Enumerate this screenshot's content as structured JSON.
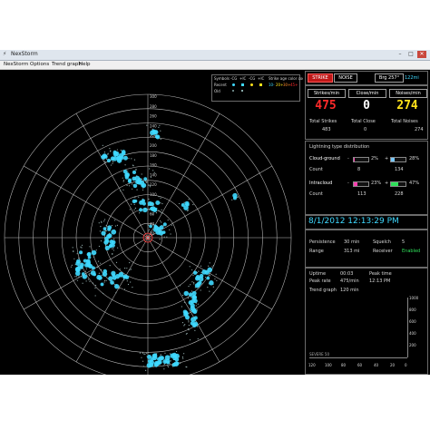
{
  "window": {
    "title": "NexStorm"
  },
  "menu": [
    "NexStorm",
    "Options",
    "Trend graph",
    "Help"
  ],
  "radar": {
    "bearing_labels": [
      "300",
      "280",
      "260",
      "240",
      "220",
      "200",
      "180",
      "160",
      "140",
      "120",
      "100",
      "80",
      "60",
      "40",
      "20"
    ],
    "legend": {
      "symbols_label": "Symbols",
      "symbol_types": [
        "-CG",
        "+IC",
        "-CG",
        "+IC"
      ],
      "row_labels": [
        "Recent",
        "Old"
      ],
      "age_label": "Strike age color codes",
      "age_values": [
        "10-",
        "20+",
        "30+",
        "45+"
      ]
    }
  },
  "panel": {
    "mode_buttons": [
      "STRIKE",
      "NOISE"
    ],
    "bearing": "Brg 257°",
    "range_readout": "122mi",
    "strikes_per_min_label": "Strikes/min",
    "strikes_per_min_value": "475",
    "close_per_min_label": "Close/min",
    "close_per_min_value": "0",
    "noises_per_min_label": "Noises/min",
    "noises_per_min_value": "274",
    "total_strikes_label": "Total Strikes",
    "total_strikes_value": "483",
    "total_close_label": "Total Close",
    "total_close_value": "0",
    "total_noises_label": "Total Noises",
    "total_noises_value": "274",
    "distribution_title": "Lightning type distribution",
    "cg_label": "Cloud-ground",
    "cg_neg_pct": "2%",
    "cg_pos_pct": "28%",
    "cg_neg_fill": 0.02,
    "cg_pos_fill": 0.28,
    "cg_count_label": "Count",
    "cg_count_neg": "8",
    "cg_count_pos": "134",
    "ic_label": "Intracloud",
    "ic_neg_pct": "23%",
    "ic_pos_pct": "47%",
    "ic_neg_fill": 0.23,
    "ic_pos_fill": 0.47,
    "ic_count_label": "Count",
    "ic_count_neg": "113",
    "ic_count_pos": "228",
    "datetime": "8/1/2012 12:13:29 PM",
    "persistence_label": "Persistence",
    "persistence_value": "30 min",
    "squelch_label": "Squelch",
    "squelch_value": "5",
    "range_label": "Range",
    "range_value": "313 mi",
    "receiver_label": "Receiver",
    "receiver_value": "Enabled",
    "uptime_label": "Uptime",
    "uptime_value": "00:03",
    "peak_time_label": "Peak time",
    "peak_time_value": "12:13 PM",
    "peak_rate_label": "Peak rate",
    "peak_rate_value": "475/min",
    "trend_label": "Trend graph",
    "trend_value": "120 min",
    "trend_y_labels": [
      "1000",
      "800",
      "600",
      "400",
      "200"
    ],
    "severe_label": "SEVERE 50",
    "trend_x_labels": [
      "120",
      "100",
      "80",
      "60",
      "40",
      "20",
      "0"
    ]
  },
  "colors": {
    "strike_red": "#ff2a2a",
    "close_white": "#ffffff",
    "noise_yellow": "#ffe21a",
    "datetime_cyan": "#3fd9ff",
    "enabled_green": "#2fe05a",
    "cg_positive_bar": "#77c8ff",
    "ic_negative_bar": "#ff3fb0",
    "ic_positive_bar": "#2fe05a"
  }
}
